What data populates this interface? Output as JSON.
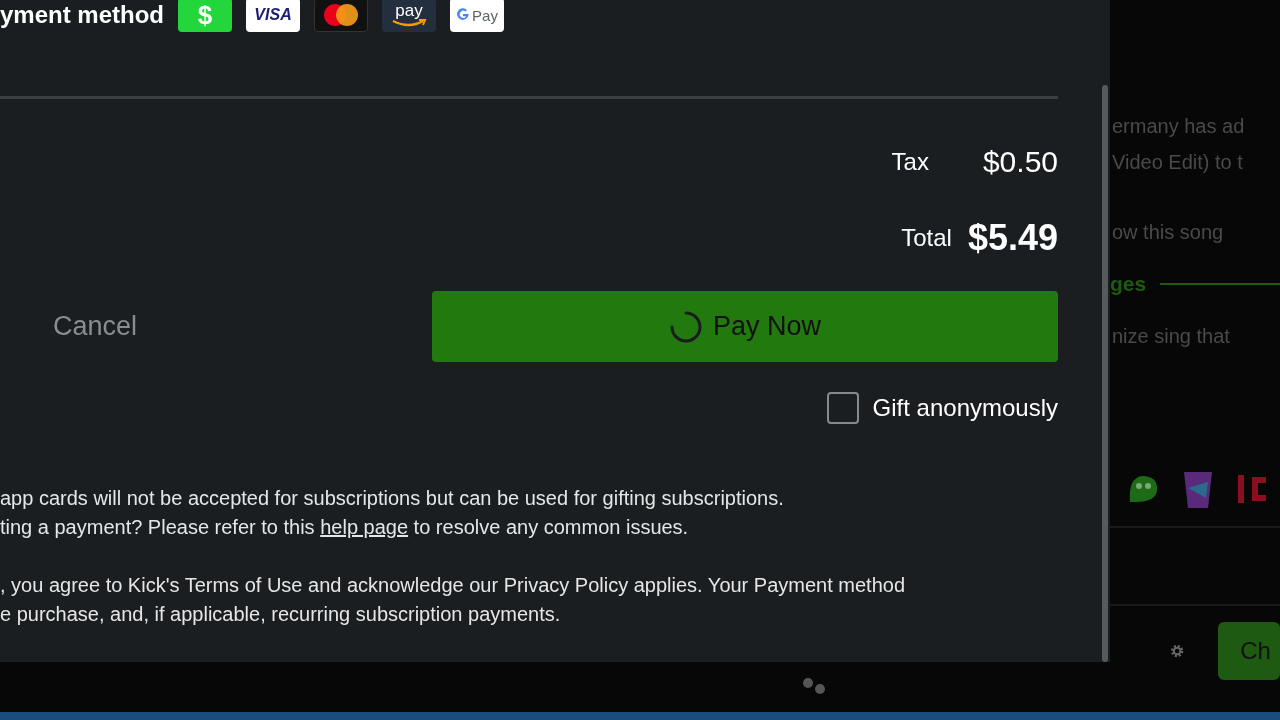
{
  "payment_header": {
    "label": "yment method",
    "methods": [
      {
        "kind": "cashapp",
        "label": "$"
      },
      {
        "kind": "visa",
        "label": "VISA"
      },
      {
        "kind": "mastercard"
      },
      {
        "kind": "amazon",
        "label": "pay"
      },
      {
        "kind": "google",
        "label": "Pay"
      }
    ]
  },
  "summary": {
    "tax_label": "Tax",
    "tax_value": "$0.50",
    "total_label": "Total",
    "total_value": "$5.49"
  },
  "cancel_button": "Cancel",
  "pay_button": {
    "label": "Pay Now",
    "loading": true
  },
  "gift": {
    "label": "Gift anonymously",
    "checked": false
  },
  "notes": [
    {
      "before": "app cards will not be accepted for subscriptions but can be used for gifting subscriptions."
    },
    {
      "before": "ting a payment? Please refer to this ",
      "link": "help page",
      "after": " to resolve any common issues."
    }
  ],
  "legal": [
    ", you agree to Kick's Terms of Use and acknowledge our Privacy Policy applies. Your Payment method",
    "e purchase, and, if applicable, recurring subscription payments."
  ],
  "background_chat": {
    "messages": [
      {
        "kind": "text",
        "lines": [
          "ermany has ad",
          "Video Edit) to t"
        ]
      },
      {
        "kind": "text",
        "lines": [
          "ow this song"
        ]
      },
      {
        "kind": "divider",
        "lines": [
          "ges"
        ]
      },
      {
        "kind": "text",
        "lines": [
          "nize sing that"
        ]
      }
    ],
    "chat_button": "Ch"
  }
}
